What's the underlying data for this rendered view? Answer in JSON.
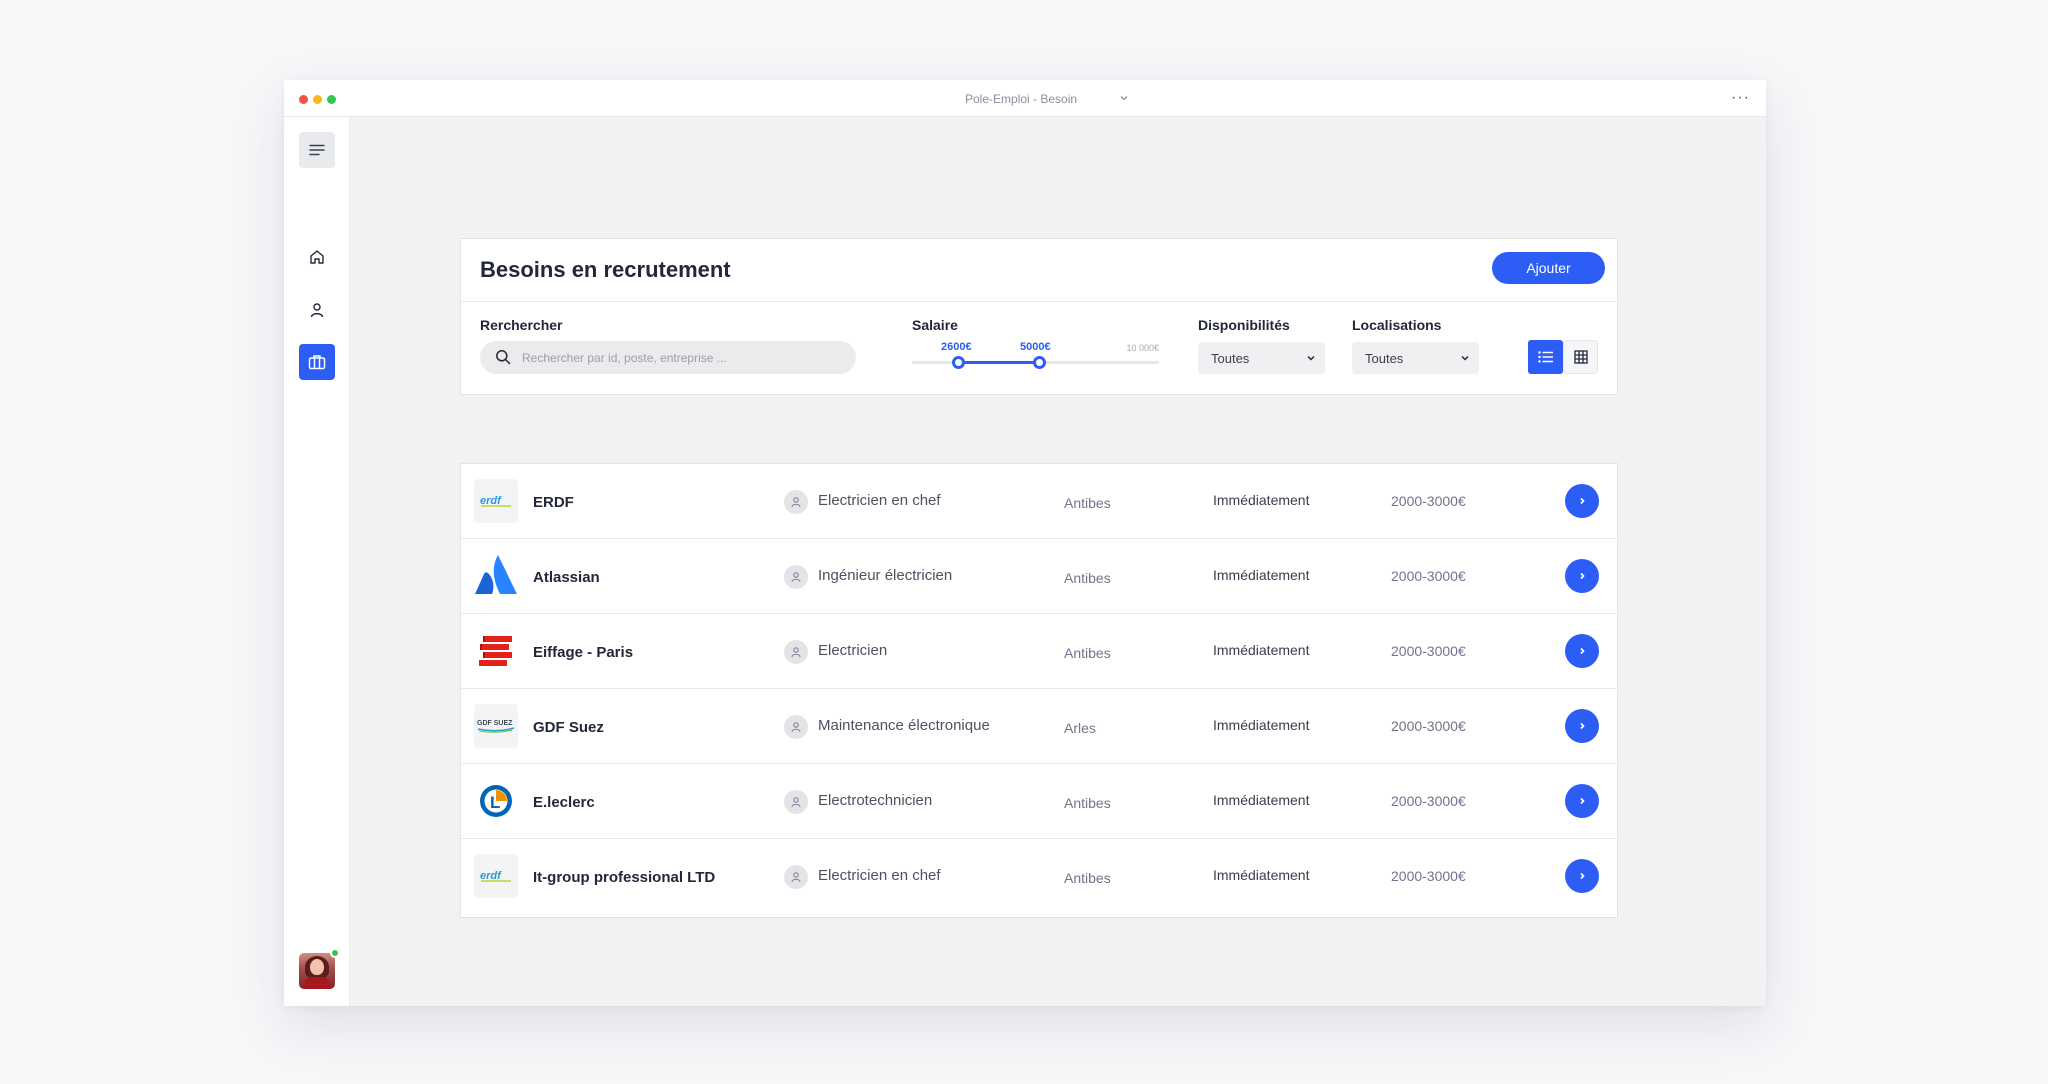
{
  "window": {
    "title": "Pole-Emploi - Besoin",
    "more_label": "···"
  },
  "sidebar": {
    "items": [
      {
        "icon": "home-icon",
        "active": false
      },
      {
        "icon": "user-icon",
        "active": false
      },
      {
        "icon": "briefcase-icon",
        "active": true
      }
    ]
  },
  "panel": {
    "title": "Besoins en recrutement",
    "add_label": "Ajouter",
    "search": {
      "label": "Rerchercher",
      "placeholder": "Rechercher par id, poste, entreprise ...",
      "value": ""
    },
    "salary": {
      "label": "Salaire",
      "min_label": "2600€",
      "max_label": "5000€",
      "range_max_label": "10 000€",
      "min_value": 2600,
      "max_value": 5000,
      "range_max": 10000
    },
    "availability": {
      "label": "Disponibilités",
      "value": "Toutes"
    },
    "location": {
      "label": "Localisations",
      "value": "Toutes"
    },
    "view": {
      "active": "list"
    }
  },
  "table": {
    "rows": [
      {
        "company": "ERDF",
        "logo": "erdf-logo",
        "position": "Electricien en chef",
        "location": "Antibes",
        "availability": "Immédiatement",
        "salary": "2000-3000€"
      },
      {
        "company": "Atlassian",
        "logo": "atlassian-logo",
        "position": "Ingénieur électricien",
        "location": "Antibes",
        "availability": "Immédiatement",
        "salary": "2000-3000€"
      },
      {
        "company": "Eiffage - Paris",
        "logo": "eiffage-logo",
        "position": "Electricien",
        "location": "Antibes",
        "availability": "Immédiatement",
        "salary": "2000-3000€"
      },
      {
        "company": "GDF Suez",
        "logo": "gdf-suez-logo",
        "position": "Maintenance électronique",
        "location": "Arles",
        "availability": "Immédiatement",
        "salary": "2000-3000€"
      },
      {
        "company": "E.leclerc",
        "logo": "leclerc-logo",
        "position": "Electrotechnicien",
        "location": "Antibes",
        "availability": "Immédiatement",
        "salary": "2000-3000€"
      },
      {
        "company": "It-group professional LTD",
        "logo": "erdf-logo",
        "position": "Electricien en chef",
        "location": "Antibes",
        "availability": "Immédiatement",
        "salary": "2000-3000€"
      }
    ]
  },
  "colors": {
    "accent": "#2c5ef5",
    "online": "#3ec150"
  },
  "logo_text": {
    "erdf": "erdf",
    "gdf": "GDF SUEZ",
    "leclerc": "L"
  }
}
